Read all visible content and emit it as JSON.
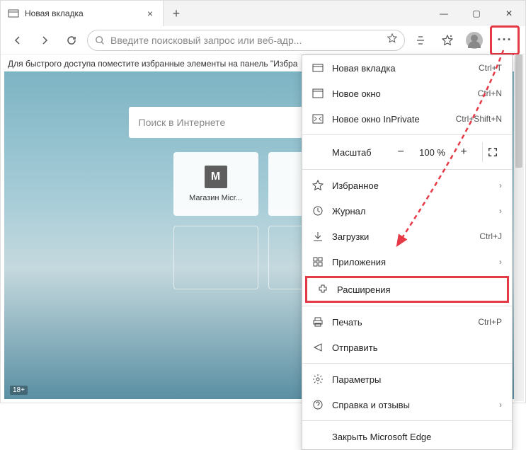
{
  "titlebar": {
    "tab_title": "Новая вкладка",
    "close_glyph": "×",
    "newtab_glyph": "+",
    "win_min": "—",
    "win_max": "▢",
    "win_close": "✕"
  },
  "toolbar": {
    "address_placeholder": "Введите поисковый запрос или веб-адр...",
    "more_glyph": "···"
  },
  "bookmarks_bar": "Для быстрого доступа поместите избранные элементы на панель \"Избра",
  "content": {
    "search_placeholder": "Поиск в Интернете",
    "tile1_letter": "М",
    "tile1_label": "Магазин Micr...",
    "age_badge": "18+"
  },
  "menu": {
    "new_tab": {
      "label": "Новая вкладка",
      "shortcut": "Ctrl+T"
    },
    "new_window": {
      "label": "Новое окно",
      "shortcut": "Ctrl+N"
    },
    "new_inprivate": {
      "label": "Новое окно InPrivate",
      "shortcut": "Ctrl+Shift+N"
    },
    "zoom": {
      "label": "Масштаб",
      "value": "100 %",
      "minus": "−",
      "plus": "+"
    },
    "favorites": {
      "label": "Избранное"
    },
    "history": {
      "label": "Журнал"
    },
    "downloads": {
      "label": "Загрузки",
      "shortcut": "Ctrl+J"
    },
    "apps": {
      "label": "Приложения"
    },
    "extensions": {
      "label": "Расширения"
    },
    "print": {
      "label": "Печать",
      "shortcut": "Ctrl+P"
    },
    "share": {
      "label": "Отправить"
    },
    "settings": {
      "label": "Параметры"
    },
    "help": {
      "label": "Справка и отзывы"
    },
    "close_edge": {
      "label": "Закрыть Microsoft Edge"
    },
    "arrow": "›"
  }
}
